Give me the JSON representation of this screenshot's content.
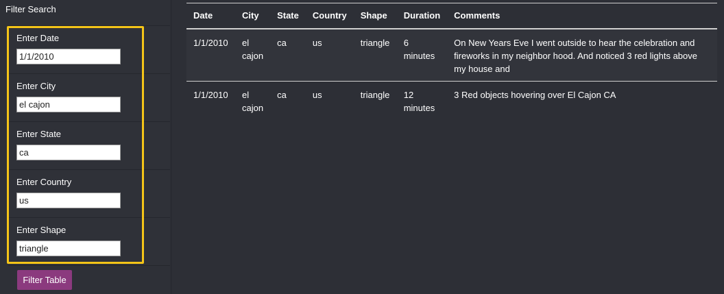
{
  "sidebar": {
    "title": "Filter Search",
    "filters": [
      {
        "label": "Enter Date",
        "value": "1/1/2010"
      },
      {
        "label": "Enter City",
        "value": "el cajon"
      },
      {
        "label": "Enter State",
        "value": "ca"
      },
      {
        "label": "Enter Country",
        "value": "us"
      },
      {
        "label": "Enter Shape",
        "value": "triangle"
      }
    ],
    "button_label": "Filter Table",
    "highlight_color": "#f5c518",
    "button_color": "#8b3a7e"
  },
  "table": {
    "headers": [
      "Date",
      "City",
      "State",
      "Country",
      "Shape",
      "Duration",
      "Comments"
    ],
    "rows": [
      [
        "1/1/2010",
        "el cajon",
        "ca",
        "us",
        "triangle",
        "6 minutes",
        "On New Years Eve I went outside to hear the celebration and fireworks in my neighbor hood. And noticed 3 red lights above my house and"
      ],
      [
        "1/1/2010",
        "el cajon",
        "ca",
        "us",
        "triangle",
        "12 minutes",
        "3 Red objects hovering over El Cajon CA"
      ]
    ]
  },
  "colors": {
    "background": "#2d2f36",
    "text": "#ffffff"
  }
}
